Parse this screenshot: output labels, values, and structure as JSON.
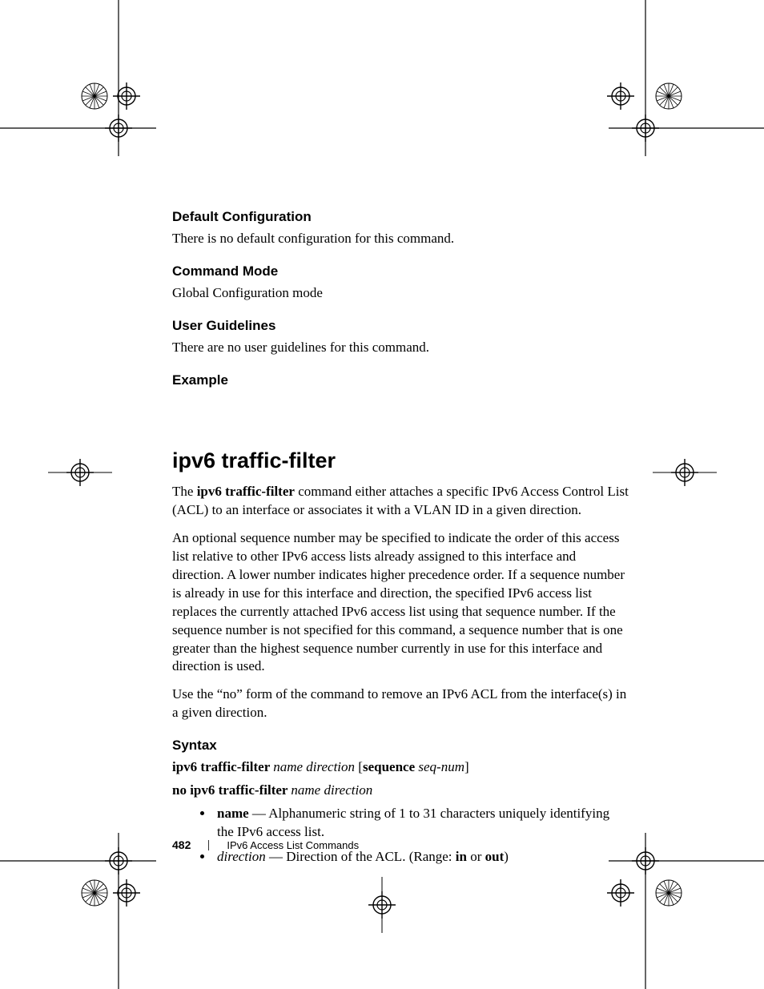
{
  "sections": {
    "default_cfg": {
      "heading": "Default Configuration",
      "text": "There is no default configuration for this command."
    },
    "cmd_mode": {
      "heading": "Command Mode",
      "text": "Global Configuration mode"
    },
    "user_guide": {
      "heading": "User Guidelines",
      "text": "There are no user guidelines for this command."
    },
    "example": {
      "heading": "Example"
    }
  },
  "command": {
    "title": "ipv6 traffic-filter",
    "intro_pre": "The ",
    "intro_bold": "ipv6 traffic-filter",
    "intro_post": " command either attaches a specific IPv6 Access Control List (ACL) to an interface or associates it with a VLAN ID in a given direction.",
    "para2": "An optional sequence number may be specified to indicate the order of this access list relative to other IPv6 access lists already assigned to this interface and direction. A lower number indicates higher precedence order. If a sequence number is already in use for this interface and direction, the specified IPv6 access list replaces the currently attached IPv6 access list using that sequence number. If the sequence number is not specified for this command, a sequence number that is one greater than the highest sequence number currently in use for this interface and direction is used.",
    "para3": "Use the “no” form of the command to remove an IPv6 ACL from the interface(s) in a given direction."
  },
  "syntax": {
    "heading": "Syntax",
    "line1": {
      "cmd": "ipv6 traffic-filter ",
      "p1": "name direction",
      "mid": " [",
      "kw": "sequence ",
      "p2": "seq-num",
      "end": "]"
    },
    "line2": {
      "cmd": "no ipv6 traffic-filter ",
      "p1": "name direction"
    },
    "bullets": {
      "b1": {
        "name": "name",
        "dash": " — Alphanumeric string of 1 to 31 characters uniquely identifying the IPv6 access list."
      },
      "b2": {
        "name": "direction",
        "dash": " — Direction of the ACL. (Range: ",
        "kw1": "in",
        "or": " or ",
        "kw2": "out",
        "end": ")"
      }
    }
  },
  "footer": {
    "page": "482",
    "chapter": "IPv6 Access List Commands"
  }
}
